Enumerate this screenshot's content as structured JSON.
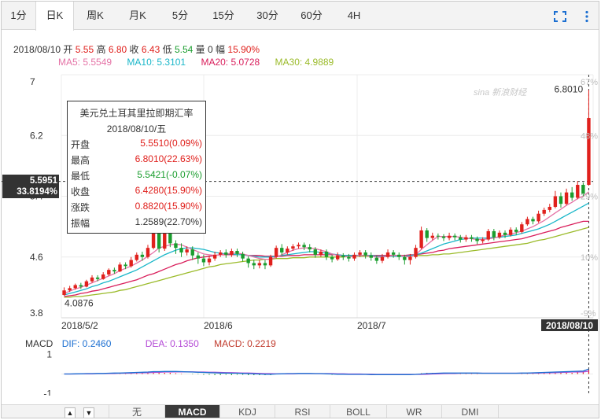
{
  "tabs": [
    {
      "label": "1分",
      "active": false
    },
    {
      "label": "日K",
      "active": true
    },
    {
      "label": "周K",
      "active": false
    },
    {
      "label": "月K",
      "active": false
    },
    {
      "label": "5分",
      "active": false
    },
    {
      "label": "15分",
      "active": false
    },
    {
      "label": "30分",
      "active": false
    },
    {
      "label": "60分",
      "active": false
    },
    {
      "label": "4H",
      "active": false
    }
  ],
  "icons": {
    "fullscreen": "fullscreen-icon",
    "more": "more-vertical-icon"
  },
  "quote": {
    "date": "2018/08/10",
    "open_label": "开",
    "open": "5.55",
    "high_label": "高",
    "high": "6.80",
    "close_label": "收",
    "close": "6.43",
    "low_label": "低",
    "low": "5.54",
    "vol_label": "量",
    "vol": "0",
    "chg_label": "幅",
    "chg": "15.90%"
  },
  "ma_line": {
    "ma5": "MA5: 5.5549",
    "ma10": "MA10: 5.3101",
    "ma20": "MA20: 5.0728",
    "ma30": "MA30: 4.9889"
  },
  "watermark": "sina 新浪财经",
  "tooltip": {
    "title": "美元兑土耳其里拉即期汇率",
    "date": "2018/08/10/五",
    "rows": [
      {
        "key": "开盘",
        "value": "5.5510(0.09%)",
        "color": "#e0201c"
      },
      {
        "key": "最高",
        "value": "6.8010(22.63%)",
        "color": "#e0201c"
      },
      {
        "key": "最低",
        "value": "5.5421(-0.07%)",
        "color": "#1a9d2e"
      },
      {
        "key": "收盘",
        "value": "6.4280(15.90%)",
        "color": "#e0201c"
      },
      {
        "key": "涨跌",
        "value": "0.8820(15.90%)",
        "color": "#e0201c"
      },
      {
        "key": "振幅",
        "value": "1.2589(22.70%)",
        "color": "#333333"
      }
    ]
  },
  "crosshair": {
    "price": "5.5951",
    "pct": "33.8194%"
  },
  "macd": {
    "label": "MACD",
    "dif": "DIF: 0.2460",
    "dea": "DEA: 0.1350",
    "macd": "MACD: 0.2219",
    "yticks": [
      "1",
      "-1"
    ]
  },
  "bottom_tabs": [
    {
      "label": "无",
      "active": false
    },
    {
      "label": "MACD",
      "active": true
    },
    {
      "label": "KDJ",
      "active": false
    },
    {
      "label": "RSI",
      "active": false
    },
    {
      "label": "BOLL",
      "active": false
    },
    {
      "label": "WR",
      "active": false
    },
    {
      "label": "DMI",
      "active": false
    }
  ],
  "arrows": {
    "up": "▲",
    "down": "▼"
  },
  "colors": {
    "up": "#e0201c",
    "down": "#1a9d2e",
    "ma5": "#e573a6",
    "ma10": "#1ab7c9",
    "ma20": "#d91e5b",
    "ma30": "#9bbb2a"
  },
  "chart_data": {
    "type": "candlestick",
    "yticks": [
      "7",
      "6.2",
      "5.4",
      "4.6",
      "3.8"
    ],
    "pct_ticks": [
      "67%",
      "48%",
      "29%",
      "10%",
      "-9%"
    ],
    "xticks": [
      "2018/5/2",
      "2018/6",
      "2018/7",
      "2018/08/10"
    ],
    "ylim": [
      3.8,
      7.0
    ],
    "max_label": "6.8010",
    "min_label": "4.0876",
    "candles": [
      [
        4.1,
        4.16,
        4.09,
        4.2
      ],
      [
        4.16,
        4.19,
        4.14,
        4.22
      ],
      [
        4.19,
        4.23,
        4.17,
        4.25
      ],
      [
        4.23,
        4.21,
        4.18,
        4.26
      ],
      [
        4.21,
        4.28,
        4.2,
        4.3
      ],
      [
        4.28,
        4.33,
        4.26,
        4.36
      ],
      [
        4.33,
        4.31,
        4.28,
        4.36
      ],
      [
        4.31,
        4.37,
        4.3,
        4.4
      ],
      [
        4.37,
        4.43,
        4.35,
        4.45
      ],
      [
        4.43,
        4.41,
        4.38,
        4.46
      ],
      [
        4.41,
        4.5,
        4.4,
        4.53
      ],
      [
        4.5,
        4.48,
        4.44,
        4.53
      ],
      [
        4.48,
        4.56,
        4.46,
        4.6
      ],
      [
        4.56,
        4.63,
        4.54,
        4.66
      ],
      [
        4.63,
        4.6,
        4.55,
        4.67
      ],
      [
        4.6,
        4.72,
        4.58,
        4.76
      ],
      [
        4.72,
        4.92,
        4.7,
        4.98
      ],
      [
        4.92,
        4.71,
        4.66,
        5.1
      ],
      [
        4.71,
        4.95,
        4.68,
        5.02
      ],
      [
        4.95,
        4.78,
        4.73,
        5.0
      ],
      [
        4.78,
        4.72,
        4.64,
        4.82
      ],
      [
        4.72,
        4.66,
        4.6,
        4.78
      ],
      [
        4.66,
        4.7,
        4.62,
        4.74
      ],
      [
        4.7,
        4.62,
        4.56,
        4.74
      ],
      [
        4.62,
        4.58,
        4.51,
        4.66
      ],
      [
        4.58,
        4.53,
        4.48,
        4.63
      ],
      [
        4.53,
        4.58,
        4.49,
        4.62
      ],
      [
        4.58,
        4.63,
        4.55,
        4.67
      ],
      [
        4.63,
        4.66,
        4.6,
        4.69
      ],
      [
        4.66,
        4.63,
        4.59,
        4.7
      ],
      [
        4.63,
        4.68,
        4.6,
        4.71
      ],
      [
        4.68,
        4.64,
        4.6,
        4.71
      ],
      [
        4.64,
        4.58,
        4.54,
        4.67
      ],
      [
        4.58,
        4.52,
        4.46,
        4.61
      ],
      [
        4.52,
        4.49,
        4.44,
        4.56
      ],
      [
        4.49,
        4.52,
        4.45,
        4.56
      ],
      [
        4.52,
        4.49,
        4.44,
        4.56
      ],
      [
        4.49,
        4.6,
        4.47,
        4.63
      ],
      [
        4.6,
        4.72,
        4.58,
        4.75
      ],
      [
        4.72,
        4.66,
        4.62,
        4.77
      ],
      [
        4.66,
        4.71,
        4.63,
        4.74
      ],
      [
        4.71,
        4.74,
        4.68,
        4.77
      ],
      [
        4.74,
        4.76,
        4.71,
        4.79
      ],
      [
        4.76,
        4.73,
        4.69,
        4.79
      ],
      [
        4.73,
        4.7,
        4.66,
        4.77
      ],
      [
        4.7,
        4.63,
        4.59,
        4.73
      ],
      [
        4.63,
        4.67,
        4.6,
        4.7
      ],
      [
        4.67,
        4.6,
        4.56,
        4.7
      ],
      [
        4.6,
        4.57,
        4.53,
        4.63
      ],
      [
        4.57,
        4.62,
        4.55,
        4.66
      ],
      [
        4.62,
        4.6,
        4.56,
        4.65
      ],
      [
        4.6,
        4.58,
        4.54,
        4.64
      ],
      [
        4.58,
        4.63,
        4.55,
        4.66
      ],
      [
        4.63,
        4.66,
        4.6,
        4.69
      ],
      [
        4.66,
        4.62,
        4.58,
        4.69
      ],
      [
        4.62,
        4.59,
        4.55,
        4.66
      ],
      [
        4.59,
        4.55,
        4.51,
        4.62
      ],
      [
        4.55,
        4.6,
        4.52,
        4.64
      ],
      [
        4.6,
        4.66,
        4.58,
        4.7
      ],
      [
        4.66,
        4.63,
        4.59,
        4.69
      ],
      [
        4.63,
        4.6,
        4.56,
        4.66
      ],
      [
        4.6,
        4.56,
        4.5,
        4.63
      ],
      [
        4.56,
        4.6,
        4.5,
        4.64
      ],
      [
        4.6,
        4.72,
        4.58,
        4.76
      ],
      [
        4.72,
        4.95,
        4.7,
        5.0
      ],
      [
        4.95,
        4.85,
        4.8,
        4.98
      ],
      [
        4.85,
        4.88,
        4.82,
        4.92
      ],
      [
        4.88,
        4.87,
        4.83,
        4.91
      ],
      [
        4.87,
        4.85,
        4.81,
        4.9
      ],
      [
        4.85,
        4.88,
        4.82,
        4.92
      ],
      [
        4.88,
        4.86,
        4.82,
        4.91
      ],
      [
        4.86,
        4.83,
        4.79,
        4.89
      ],
      [
        4.83,
        4.86,
        4.8,
        4.89
      ],
      [
        4.86,
        4.84,
        4.8,
        4.89
      ],
      [
        4.84,
        4.81,
        4.77,
        4.87
      ],
      [
        4.81,
        4.83,
        4.78,
        4.86
      ],
      [
        4.83,
        4.94,
        4.81,
        4.97
      ],
      [
        4.94,
        4.86,
        4.82,
        4.97
      ],
      [
        4.86,
        4.92,
        4.84,
        4.95
      ],
      [
        4.92,
        4.89,
        4.85,
        4.95
      ],
      [
        4.89,
        4.96,
        4.87,
        4.99
      ],
      [
        4.96,
        4.93,
        4.89,
        4.99
      ],
      [
        4.93,
        5.03,
        4.91,
        5.06
      ],
      [
        5.03,
        5.1,
        5.01,
        5.13
      ],
      [
        5.1,
        5.07,
        5.03,
        5.13
      ],
      [
        5.07,
        5.17,
        5.05,
        5.21
      ],
      [
        5.17,
        5.22,
        5.14,
        5.25
      ],
      [
        5.22,
        5.26,
        5.19,
        5.3
      ],
      [
        5.26,
        5.4,
        5.24,
        5.47
      ],
      [
        5.4,
        5.3,
        5.25,
        5.45
      ],
      [
        5.3,
        5.45,
        5.28,
        5.5
      ],
      [
        5.45,
        5.38,
        5.34,
        5.52
      ],
      [
        5.38,
        5.55,
        5.36,
        5.6
      ],
      [
        5.55,
        5.43,
        5.4,
        5.58
      ],
      [
        5.55,
        6.43,
        5.54,
        6.8
      ]
    ],
    "ma5": [
      4.12,
      4.15,
      4.18,
      4.2,
      4.23,
      4.26,
      4.29,
      4.32,
      4.35,
      4.38,
      4.42,
      4.45,
      4.48,
      4.52,
      4.56,
      4.61,
      4.66,
      4.72,
      4.74,
      4.76,
      4.77,
      4.76,
      4.73,
      4.7,
      4.67,
      4.64,
      4.63,
      4.62,
      4.63,
      4.64,
      4.65,
      4.65,
      4.64,
      4.62,
      4.6,
      4.58,
      4.57,
      4.57,
      4.6,
      4.63,
      4.66,
      4.69,
      4.71,
      4.72,
      4.72,
      4.71,
      4.69,
      4.67,
      4.64,
      4.62,
      4.61,
      4.6,
      4.61,
      4.62,
      4.62,
      4.61,
      4.6,
      4.6,
      4.61,
      4.62,
      4.62,
      4.61,
      4.6,
      4.63,
      4.7,
      4.76,
      4.82,
      4.87,
      4.87,
      4.87,
      4.87,
      4.86,
      4.85,
      4.84,
      4.83,
      4.83,
      4.84,
      4.85,
      4.87,
      4.89,
      4.9,
      4.92,
      4.94,
      4.97,
      5.0,
      5.04,
      5.08,
      5.13,
      5.18,
      5.23,
      5.28,
      5.32,
      5.37,
      5.4,
      5.46
    ],
    "ma10": [
      4.1,
      4.12,
      4.14,
      4.16,
      4.18,
      4.21,
      4.23,
      4.26,
      4.28,
      4.31,
      4.34,
      4.37,
      4.4,
      4.43,
      4.47,
      4.51,
      4.55,
      4.59,
      4.63,
      4.66,
      4.69,
      4.71,
      4.72,
      4.72,
      4.71,
      4.7,
      4.68,
      4.66,
      4.65,
      4.64,
      4.64,
      4.63,
      4.63,
      4.62,
      4.61,
      4.6,
      4.6,
      4.6,
      4.61,
      4.62,
      4.63,
      4.64,
      4.65,
      4.66,
      4.67,
      4.67,
      4.66,
      4.65,
      4.64,
      4.63,
      4.62,
      4.62,
      4.62,
      4.62,
      4.62,
      4.62,
      4.61,
      4.61,
      4.61,
      4.61,
      4.61,
      4.61,
      4.62,
      4.63,
      4.65,
      4.68,
      4.71,
      4.74,
      4.77,
      4.79,
      4.81,
      4.83,
      4.84,
      4.85,
      4.85,
      4.85,
      4.85,
      4.86,
      4.86,
      4.87,
      4.88,
      4.89,
      4.91,
      4.93,
      4.95,
      4.97,
      5.0,
      5.03,
      5.07,
      5.11,
      5.15,
      5.19,
      5.23,
      5.27,
      5.31
    ],
    "ma20": [
      4.08,
      4.09,
      4.1,
      4.12,
      4.13,
      4.15,
      4.16,
      4.18,
      4.2,
      4.22,
      4.24,
      4.26,
      4.28,
      4.3,
      4.33,
      4.36,
      4.38,
      4.41,
      4.44,
      4.47,
      4.5,
      4.52,
      4.55,
      4.57,
      4.59,
      4.6,
      4.61,
      4.62,
      4.63,
      4.63,
      4.63,
      4.63,
      4.63,
      4.62,
      4.62,
      4.62,
      4.61,
      4.61,
      4.61,
      4.61,
      4.62,
      4.62,
      4.62,
      4.63,
      4.63,
      4.63,
      4.63,
      4.63,
      4.63,
      4.63,
      4.62,
      4.62,
      4.62,
      4.62,
      4.62,
      4.62,
      4.62,
      4.62,
      4.62,
      4.62,
      4.62,
      4.62,
      4.63,
      4.63,
      4.64,
      4.65,
      4.66,
      4.68,
      4.69,
      4.71,
      4.72,
      4.73,
      4.74,
      4.75,
      4.76,
      4.77,
      4.78,
      4.79,
      4.8,
      4.81,
      4.82,
      4.83,
      4.84,
      4.86,
      4.88,
      4.9,
      4.92,
      4.94,
      4.96,
      4.99,
      5.01,
      5.03,
      5.05,
      5.07,
      5.07
    ],
    "ma30": [
      4.07,
      4.07,
      4.08,
      4.08,
      4.09,
      4.1,
      4.11,
      4.12,
      4.13,
      4.14,
      4.16,
      4.17,
      4.19,
      4.21,
      4.23,
      4.25,
      4.27,
      4.29,
      4.31,
      4.33,
      4.35,
      4.37,
      4.39,
      4.41,
      4.43,
      4.45,
      4.47,
      4.48,
      4.5,
      4.51,
      4.52,
      4.53,
      4.54,
      4.55,
      4.56,
      4.56,
      4.57,
      4.57,
      4.58,
      4.58,
      4.58,
      4.59,
      4.59,
      4.59,
      4.6,
      4.6,
      4.6,
      4.6,
      4.6,
      4.6,
      4.6,
      4.61,
      4.61,
      4.61,
      4.61,
      4.61,
      4.61,
      4.61,
      4.61,
      4.61,
      4.61,
      4.61,
      4.61,
      4.62,
      4.62,
      4.62,
      4.63,
      4.63,
      4.64,
      4.64,
      4.65,
      4.66,
      4.67,
      4.68,
      4.69,
      4.7,
      4.71,
      4.72,
      4.73,
      4.74,
      4.75,
      4.76,
      4.77,
      4.78,
      4.8,
      4.82,
      4.83,
      4.85,
      4.87,
      4.89,
      4.91,
      4.93,
      4.95,
      4.97,
      4.99
    ],
    "macd_ylim": [
      -1.3,
      1.3
    ],
    "dif": [
      0.0,
      0.0,
      0.01,
      0.01,
      0.02,
      0.02,
      0.03,
      0.03,
      0.04,
      0.05,
      0.05,
      0.06,
      0.07,
      0.08,
      0.09,
      0.1,
      0.12,
      0.12,
      0.13,
      0.13,
      0.13,
      0.12,
      0.11,
      0.1,
      0.09,
      0.08,
      0.07,
      0.06,
      0.05,
      0.05,
      0.04,
      0.04,
      0.03,
      0.02,
      0.01,
      0.0,
      -0.01,
      -0.01,
      0.0,
      0.01,
      0.02,
      0.02,
      0.03,
      0.03,
      0.03,
      0.02,
      0.02,
      0.01,
      0.0,
      -0.01,
      -0.01,
      -0.02,
      -0.02,
      -0.02,
      -0.02,
      -0.03,
      -0.03,
      -0.03,
      -0.03,
      -0.03,
      -0.03,
      -0.03,
      -0.03,
      -0.02,
      0.0,
      0.02,
      0.03,
      0.04,
      0.05,
      0.05,
      0.05,
      0.05,
      0.05,
      0.05,
      0.05,
      0.04,
      0.04,
      0.04,
      0.04,
      0.04,
      0.04,
      0.04,
      0.05,
      0.05,
      0.06,
      0.07,
      0.08,
      0.09,
      0.1,
      0.11,
      0.12,
      0.13,
      0.14,
      0.15,
      0.25
    ],
    "dea": [
      0.0,
      0.0,
      0.0,
      0.01,
      0.01,
      0.01,
      0.02,
      0.02,
      0.03,
      0.03,
      0.04,
      0.04,
      0.05,
      0.06,
      0.06,
      0.07,
      0.08,
      0.09,
      0.1,
      0.1,
      0.11,
      0.11,
      0.11,
      0.11,
      0.1,
      0.1,
      0.09,
      0.09,
      0.08,
      0.07,
      0.07,
      0.06,
      0.05,
      0.05,
      0.04,
      0.03,
      0.02,
      0.02,
      0.01,
      0.01,
      0.01,
      0.01,
      0.02,
      0.02,
      0.02,
      0.02,
      0.02,
      0.02,
      0.02,
      0.01,
      0.01,
      0.0,
      0.0,
      0.0,
      -0.01,
      -0.01,
      -0.02,
      -0.02,
      -0.02,
      -0.02,
      -0.02,
      -0.02,
      -0.02,
      -0.02,
      -0.02,
      -0.01,
      0.0,
      0.01,
      0.02,
      0.03,
      0.03,
      0.04,
      0.04,
      0.04,
      0.04,
      0.04,
      0.04,
      0.04,
      0.04,
      0.04,
      0.04,
      0.04,
      0.04,
      0.04,
      0.05,
      0.05,
      0.06,
      0.06,
      0.07,
      0.08,
      0.09,
      0.1,
      0.1,
      0.11,
      0.14
    ]
  }
}
